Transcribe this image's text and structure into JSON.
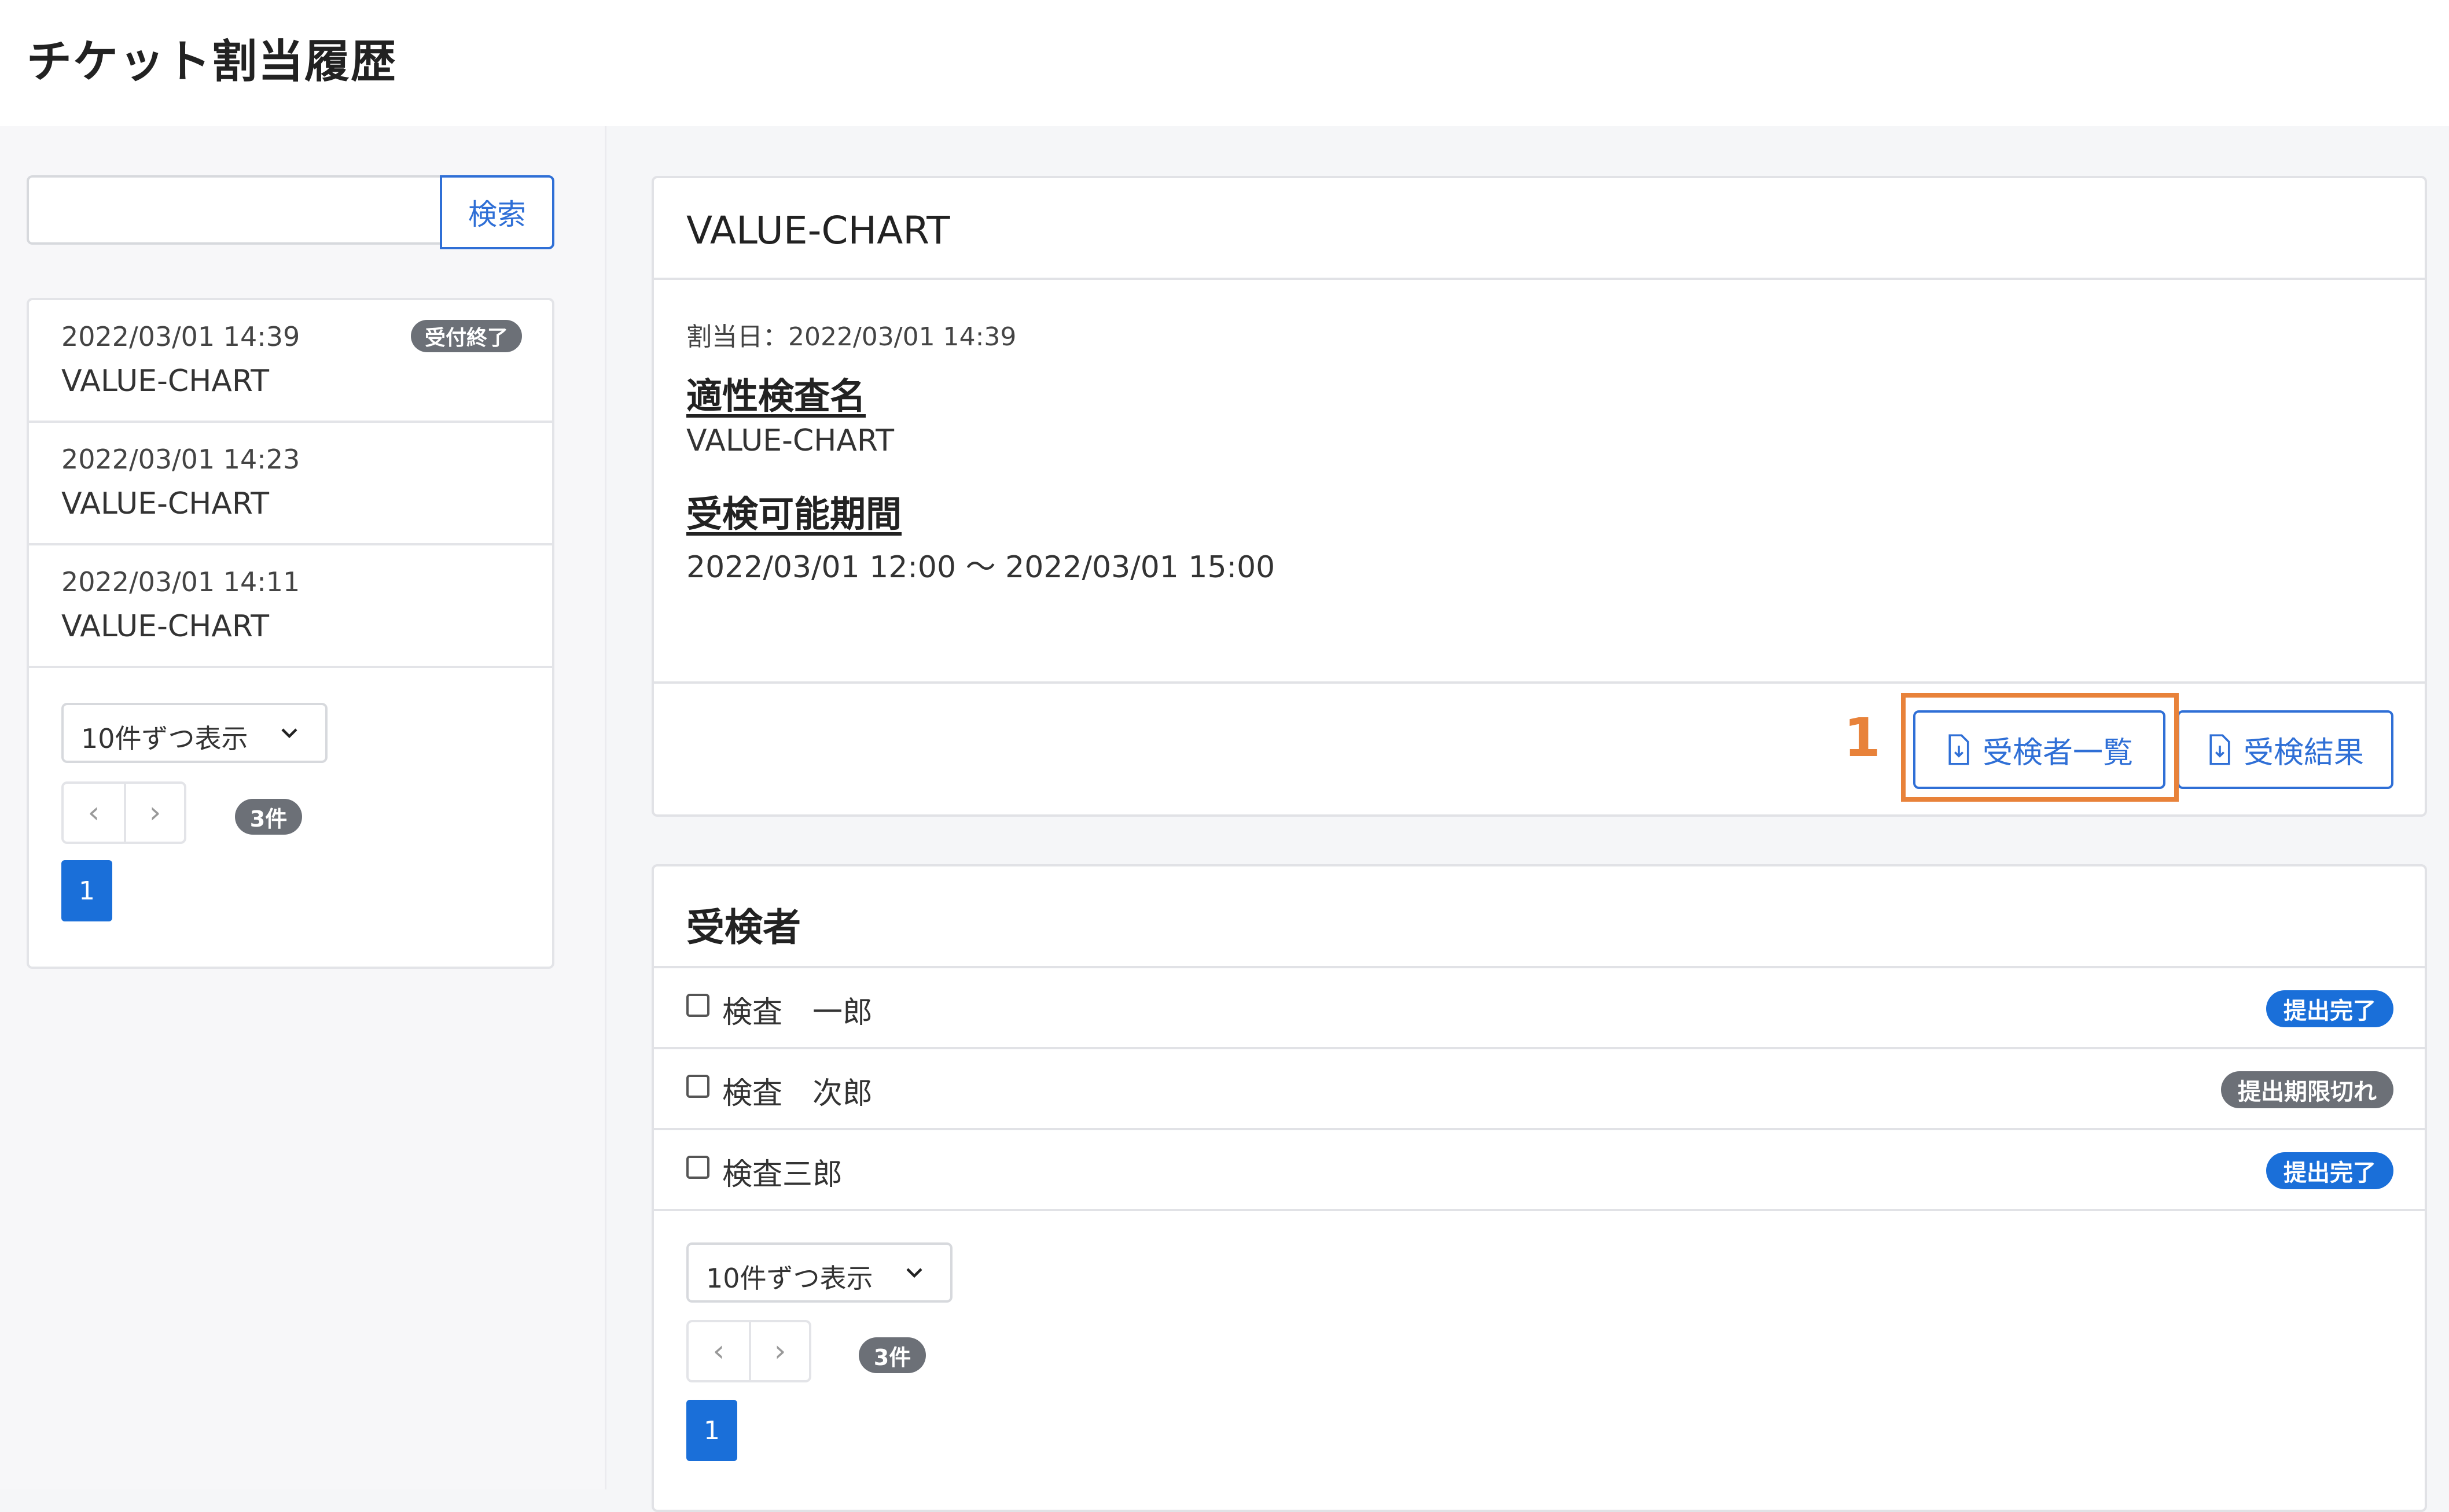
{
  "header": {
    "title": "チケット割当履歴"
  },
  "sidebar": {
    "search": {
      "value": "",
      "button_label": "検索"
    },
    "history": [
      {
        "date": "2022/03/01 14:39",
        "name": "VALUE-CHART",
        "badge": "受付終了"
      },
      {
        "date": "2022/03/01 14:23",
        "name": "VALUE-CHART"
      },
      {
        "date": "2022/03/01 14:11",
        "name": "VALUE-CHART"
      }
    ],
    "per_page": "10件ずつ表示",
    "count": "3件",
    "page": "1"
  },
  "detail": {
    "title": "VALUE-CHART",
    "assign_date": "割当日：2022/03/01 14:39",
    "test_name_heading": "適性検査名",
    "test_name": "VALUE-CHART",
    "period_heading": "受検可能期間",
    "period": "2022/03/01 12:00 〜 2022/03/01 15:00",
    "buttons": {
      "examinee_list": "受検者一覧",
      "results": "受検結果"
    },
    "step_number": "1"
  },
  "examinees": {
    "title": "受検者",
    "rows": [
      {
        "name": "検査　一郎",
        "status": "提出完了",
        "status_color": "#1a6fd9"
      },
      {
        "name": "検査　次郎",
        "status": "提出期限切れ",
        "status_color": "#6c7077"
      },
      {
        "name": "検査三郎",
        "status": "提出完了",
        "status_color": "#1a6fd9"
      }
    ],
    "per_page": "10件ずつ表示",
    "count": "3件",
    "page": "1"
  },
  "colors": {
    "accent": "#1a6fd9",
    "highlight": "#e8823a",
    "muted_badge": "#6c7077"
  },
  "icons": {
    "download": "file-download-icon",
    "chevron": "chevron-down-icon",
    "prev": "chevron-left-icon",
    "next": "chevron-right-icon"
  }
}
